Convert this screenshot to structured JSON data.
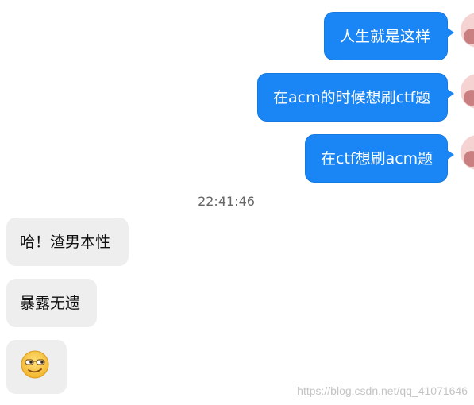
{
  "chat": {
    "outgoing": [
      {
        "text": "人生就是这样"
      },
      {
        "text": "在acm的时候想刷ctf题"
      },
      {
        "text": "在ctf想刷acm题"
      }
    ],
    "timestamp": "22:41:46",
    "incoming": [
      {
        "text": "哈！渣男本性"
      },
      {
        "text": "暴露无遗"
      },
      {
        "emoji": "smirk-sunglasses-emoji"
      }
    ]
  },
  "watermark": "https://blog.csdn.net/qq_41071646",
  "colors": {
    "outgoing_bubble": "#1a86f5",
    "incoming_bubble": "#eeeeee",
    "background": "#ffffff"
  }
}
